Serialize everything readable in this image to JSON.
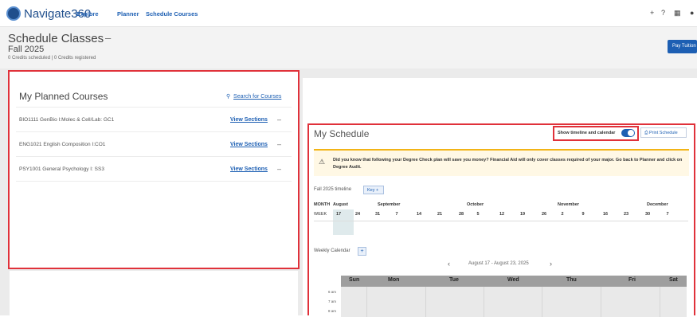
{
  "brand": "Navigate360",
  "nav": [
    "Explore",
    "Planner",
    "Schedule Courses"
  ],
  "header": {
    "title": "Schedule Classes",
    "term": "Fall 2025",
    "credits": "0 Credits scheduled | 0 Credits registered",
    "pay_button": "Pay Tuition"
  },
  "planned": {
    "title": "My Planned Courses",
    "search_link": "Search for Courses",
    "view_label": "View Sections",
    "courses": [
      "BIO1111 GenBio I:Molec & Cell/Lab: GC1",
      "ENG1021 English Composition I:CO1",
      "PSY1001 General Psychology I: SS3"
    ]
  },
  "schedule": {
    "title": "My Schedule",
    "toggle_label": "Show timeline and calendar",
    "toggle_on": true,
    "print_button": "Print Schedule",
    "alert": "Did you know that following your Degree Check plan will save you money? Financial Aid will only cover classes required of your major. Go back to Planner and click on Degree Audit.",
    "timeline_label": "Fall 2025 timeline",
    "key_button": "Key",
    "month_header": "MONTH",
    "week_header": "WEEK",
    "months": [
      "August",
      "September",
      "October",
      "November",
      "December"
    ],
    "weeks": [
      "17",
      "24",
      "31",
      "7",
      "14",
      "21",
      "28",
      "5",
      "12",
      "19",
      "26",
      "2",
      "9",
      "16",
      "23",
      "30",
      "7"
    ],
    "calendar_label": "Weekly Calendar",
    "date_range": "August 17 - August 23, 2025",
    "days": [
      "Sun",
      "Mon",
      "Tue",
      "Wed",
      "Thu",
      "Fri",
      "Sat"
    ],
    "times": [
      "6 am",
      "7 am",
      "8 am"
    ]
  }
}
